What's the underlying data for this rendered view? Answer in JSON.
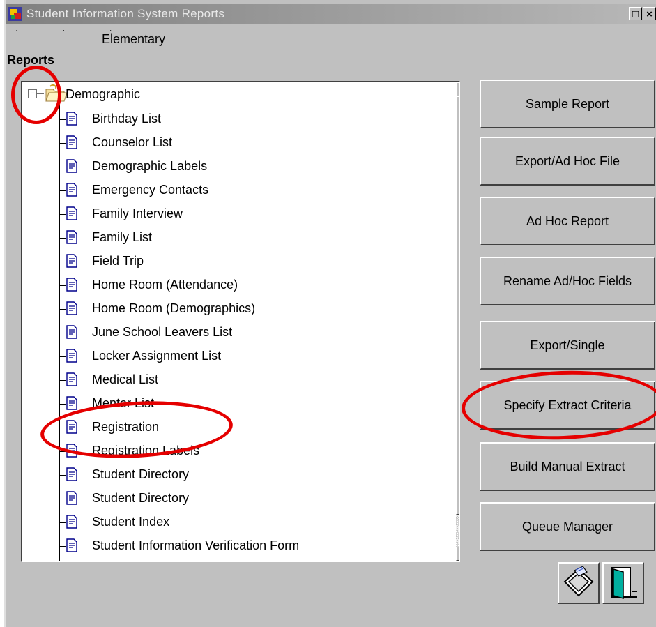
{
  "window": {
    "title": "Student Information System Reports",
    "school": "Elementary",
    "restore_glyph": "□",
    "close_glyph": "×"
  },
  "reports_heading": "Reports",
  "tree": {
    "root": {
      "expander": "−",
      "label": "Demographic"
    },
    "items": [
      "Birthday List",
      "Counselor List",
      "Demographic Labels",
      "Emergency Contacts",
      "Family Interview",
      "Family List",
      "Field Trip",
      "Home Room (Attendance)",
      "Home Room (Demographics)",
      "June School Leavers List",
      "Locker Assignment List",
      "Medical List",
      "Mentor List",
      "Registration",
      "Registration Labels",
      "Student Directory",
      "Student Directory",
      "Student Index",
      "Student Information Verification Form"
    ]
  },
  "buttons": {
    "sample_report": "Sample Report",
    "export_adhoc_file": "Export/Ad Hoc File",
    "adhoc_report": "Ad Hoc Report",
    "rename_adhoc_fields": "Rename Ad/Hoc Fields",
    "export_single": "Export/Single",
    "specify_extract_criteria": "Specify Extract Criteria",
    "build_manual_extract": "Build Manual Extract",
    "queue_manager": "Queue Manager"
  },
  "icons": {
    "print": "printer-icon",
    "exit": "exit-door-icon",
    "document": "document-icon",
    "folder": "open-folder-icon"
  },
  "colors": {
    "annotation_red": "#e50000",
    "window_gray": "#c0c0c0",
    "tree_bg": "#ffffff"
  }
}
